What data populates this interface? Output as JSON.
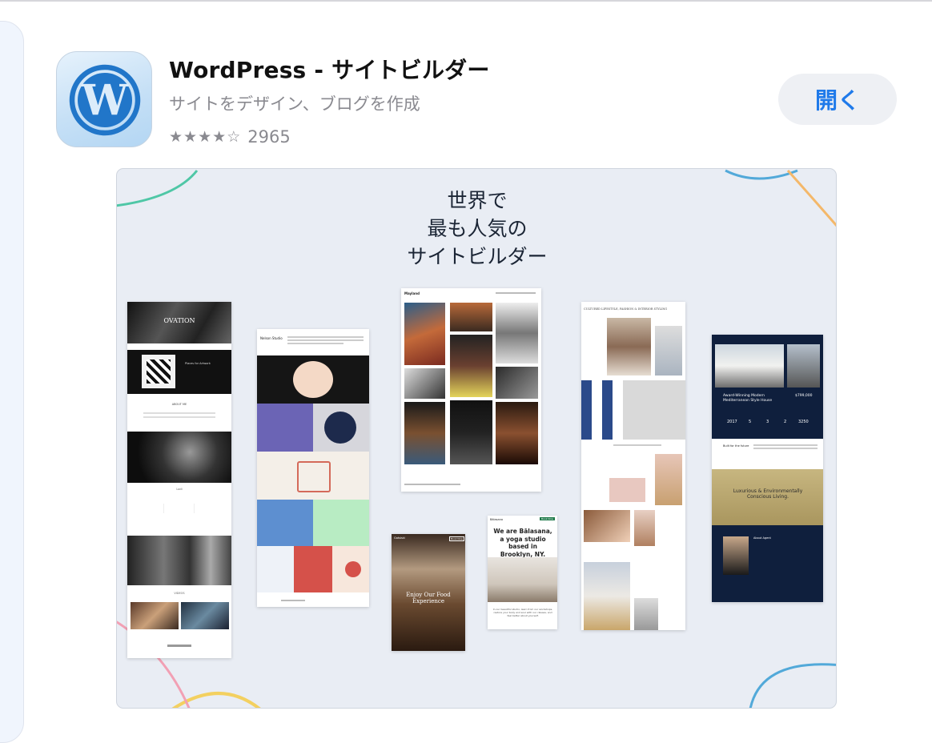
{
  "app": {
    "name": "WordPress - サイトビルダー",
    "subtitle": "サイトをデザイン、ブログを作成",
    "rating_count": "2965",
    "open_label": "開く",
    "icon": "wordpress-logo-icon"
  },
  "rating": {
    "value": 4,
    "max": 5
  },
  "screenshot": {
    "headline": [
      "世界で",
      "最も人気の",
      "サイトビルダー"
    ],
    "panel_ovation": {
      "title": "OVATION",
      "section_1": "Places for Artwork",
      "section_2": "ABOUT ME",
      "section_3": "Lodi",
      "section_4": "VIDEOS"
    },
    "panel_illustration": {
      "brand": "Nelson Studio"
    },
    "panel_photo": {
      "brand": "Mayland"
    },
    "panel_fashion": {
      "header": "CULTURED LIFESTYLE, FASHION & INTERIOR STYLING"
    },
    "panel_real_estate": {
      "headline": "Award-Winning Modern Mediterranean Style House",
      "price": "$799,000",
      "stats": [
        "2017",
        "5",
        "3",
        "2",
        "3250"
      ],
      "section": "Built for the future",
      "banner": "Luxurious & Environmentally Conscious Living.",
      "agent": "About Agent"
    },
    "panel_food": {
      "brand": "Gatsiski",
      "button": "Book Now",
      "headline": "Enjoy Our Food Experience"
    },
    "panel_yoga": {
      "brand": "Bālasana",
      "button": "Book Now",
      "headline": "We are Bālasana, a yoga studio based in Brooklyn, NY.",
      "body": "In our beautiful studio, learn from our workshops, restore your body and soul with our classes, and feel better about yourself."
    }
  },
  "colors": {
    "accent": "#1f7aea",
    "button_bg": "#eef0f4",
    "gray_text": "#8a8a90",
    "screenshot_bg": "#e9edf4",
    "wordpress_blue": "#2176c9"
  }
}
